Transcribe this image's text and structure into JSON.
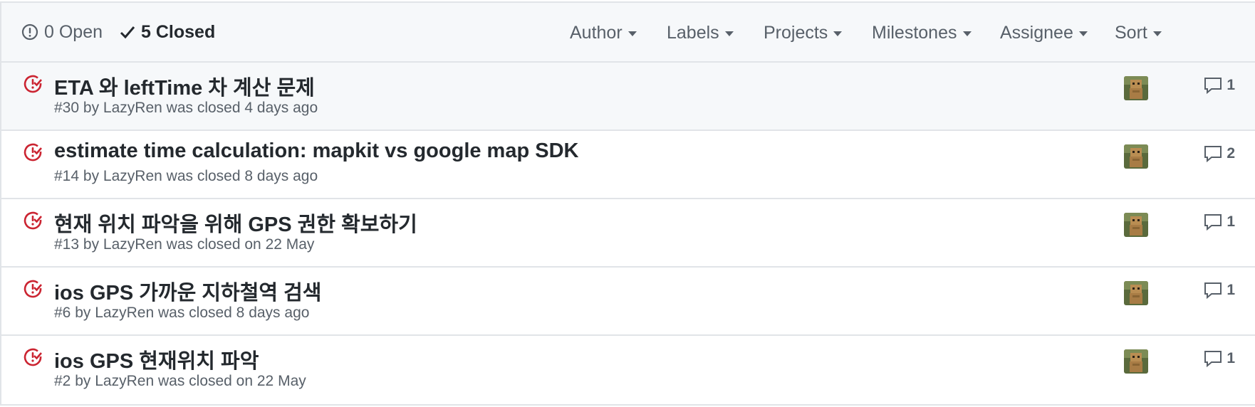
{
  "states": {
    "open_label": "0 Open",
    "closed_label": "5 Closed"
  },
  "filters": [
    {
      "label": "Author"
    },
    {
      "label": "Labels"
    },
    {
      "label": "Projects"
    },
    {
      "label": "Milestones"
    },
    {
      "label": "Assignee"
    },
    {
      "label": "Sort"
    }
  ],
  "issues": [
    {
      "title": "ETA 와 leftTime 차 계산 문제",
      "number": "#30",
      "author": "LazyRen",
      "closed_text": "was closed 4 days ago",
      "comments": "1"
    },
    {
      "title": "estimate time calculation: mapkit vs google map SDK",
      "number": "#14",
      "author": "LazyRen",
      "closed_text": "was closed 8 days ago",
      "comments": "2"
    },
    {
      "title": "현재 위치 파악을 위해 GPS 권한 확보하기",
      "number": "#13",
      "author": "LazyRen",
      "closed_text": "was closed on 22 May",
      "comments": "1"
    },
    {
      "title": "ios GPS 가까운 지하철역 검색",
      "number": "#6",
      "author": "LazyRen",
      "closed_text": "was closed 8 days ago",
      "comments": "1"
    },
    {
      "title": "ios GPS 현재위치 파악",
      "number": "#2",
      "author": "LazyRen",
      "closed_text": "was closed on 22 May",
      "comments": "1"
    }
  ],
  "by_word": "by",
  "colors": {
    "closed_icon": "#cb2431",
    "muted": "#586069",
    "border": "#e1e4e8"
  }
}
